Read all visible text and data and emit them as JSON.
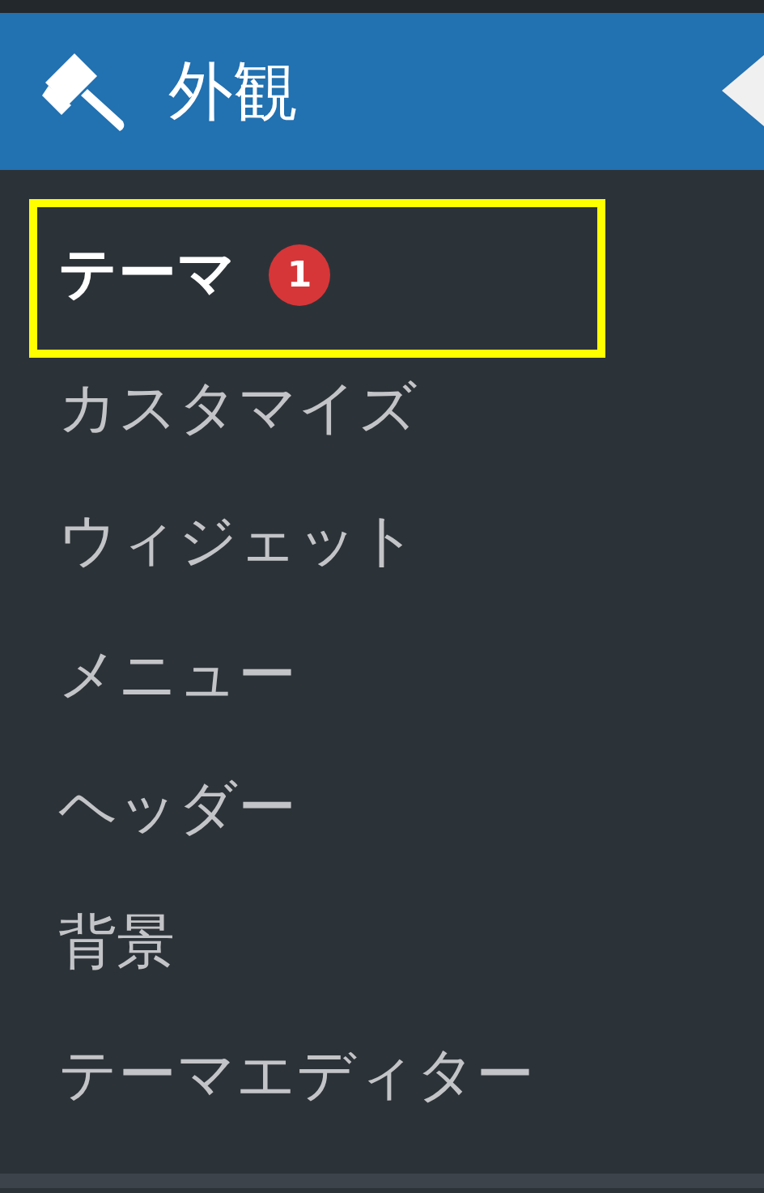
{
  "menu": {
    "label": "外観",
    "current": true
  },
  "submenu": [
    {
      "label": "テーマ",
      "selected": true,
      "badge": "1",
      "highlighted": true
    },
    {
      "label": "カスタマイズ",
      "selected": false,
      "highlighted": false
    },
    {
      "label": "ウィジェット",
      "selected": false,
      "highlighted": false
    },
    {
      "label": "メニュー",
      "selected": false,
      "highlighted": false
    },
    {
      "label": "ヘッダー",
      "selected": false,
      "highlighted": false
    },
    {
      "label": "背景",
      "selected": false,
      "highlighted": false
    },
    {
      "label": "テーマエディター",
      "selected": false,
      "highlighted": false
    }
  ]
}
